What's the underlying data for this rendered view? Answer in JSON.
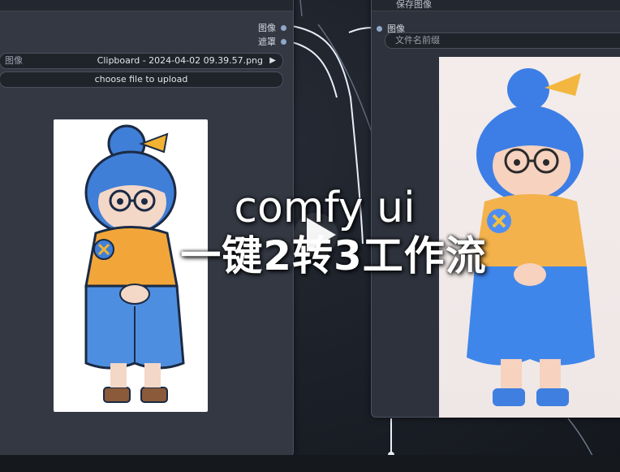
{
  "left_node": {
    "title": "",
    "outputs": [
      "图像",
      "遮罩"
    ],
    "image_widget": {
      "label": "图像",
      "value": "Clipboard - 2024-04-02 09.39.57.png"
    },
    "upload_button": "choose file to upload"
  },
  "right_node": {
    "title": "保存图像",
    "input_label": "图像",
    "filename_placeholder": "文件名前缀"
  },
  "overlay": {
    "line1": "comfy ui",
    "line2": "一键2转3工作流"
  },
  "colors": {
    "canvas": "#1b1f27",
    "node": "#333843",
    "wire": "#e8eef8",
    "port": "#8fa7c9"
  },
  "icons": {
    "play": "play-icon",
    "arrow": "triangle-right-icon"
  }
}
